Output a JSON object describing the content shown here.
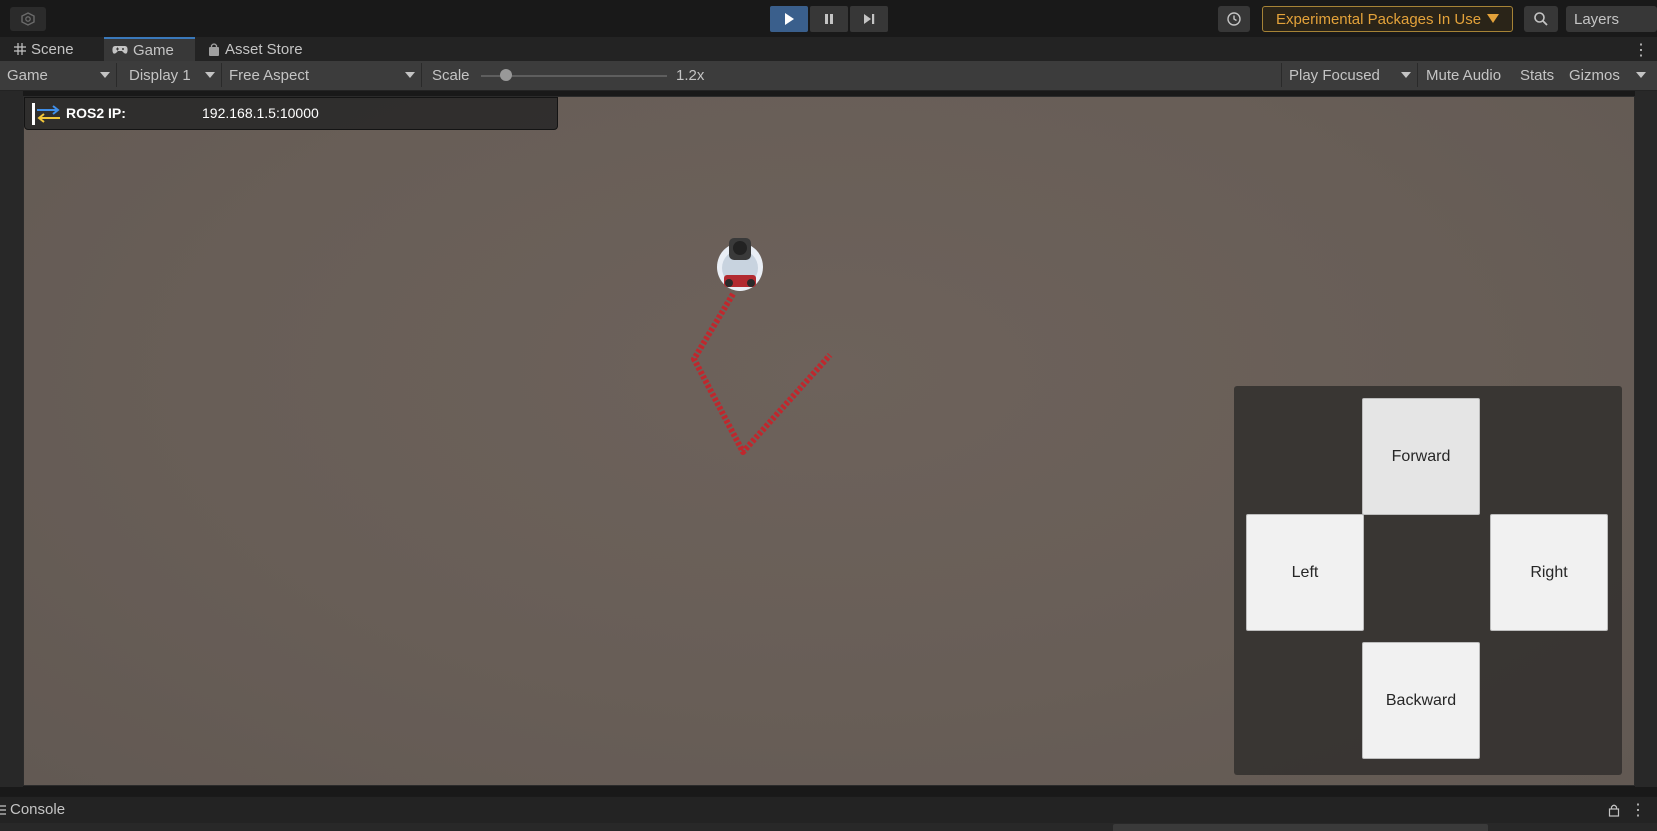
{
  "toolbar_top": {
    "left_icon": "cloud-icon",
    "play_icons": [
      "play-icon",
      "pause-icon",
      "step-icon"
    ],
    "history_icon": "history-icon",
    "experimental_label": "Experimental Packages In Use",
    "search_icon": "search-icon",
    "layers_label": "Layers"
  },
  "tabs": [
    {
      "label": "Scene",
      "icon": "grid-icon"
    },
    {
      "label": "Game",
      "icon": "gamepad-icon"
    },
    {
      "label": "Asset Store",
      "icon": "bag-icon"
    }
  ],
  "game_toolbar": {
    "view_select": "Game",
    "display_select": "Display 1",
    "aspect_select": "Free Aspect",
    "scale_label": "Scale",
    "scale_value": "1.2x",
    "scale_fraction": 0.1,
    "play_mode": "Play Focused",
    "mute_audio": "Mute Audio",
    "stats": "Stats",
    "gizmos": "Gizmos"
  },
  "ros_panel": {
    "label": "ROS2 IP:",
    "value": "192.168.1.5:10000"
  },
  "controls": {
    "forward": "Forward",
    "left": "Left",
    "right": "Right",
    "backward": "Backward"
  },
  "console": {
    "label": "Console"
  },
  "colors": {
    "accent": "#3a79bb",
    "warning": "#e3a23a",
    "ground": "#6a6059",
    "trail": "#c0272d"
  }
}
